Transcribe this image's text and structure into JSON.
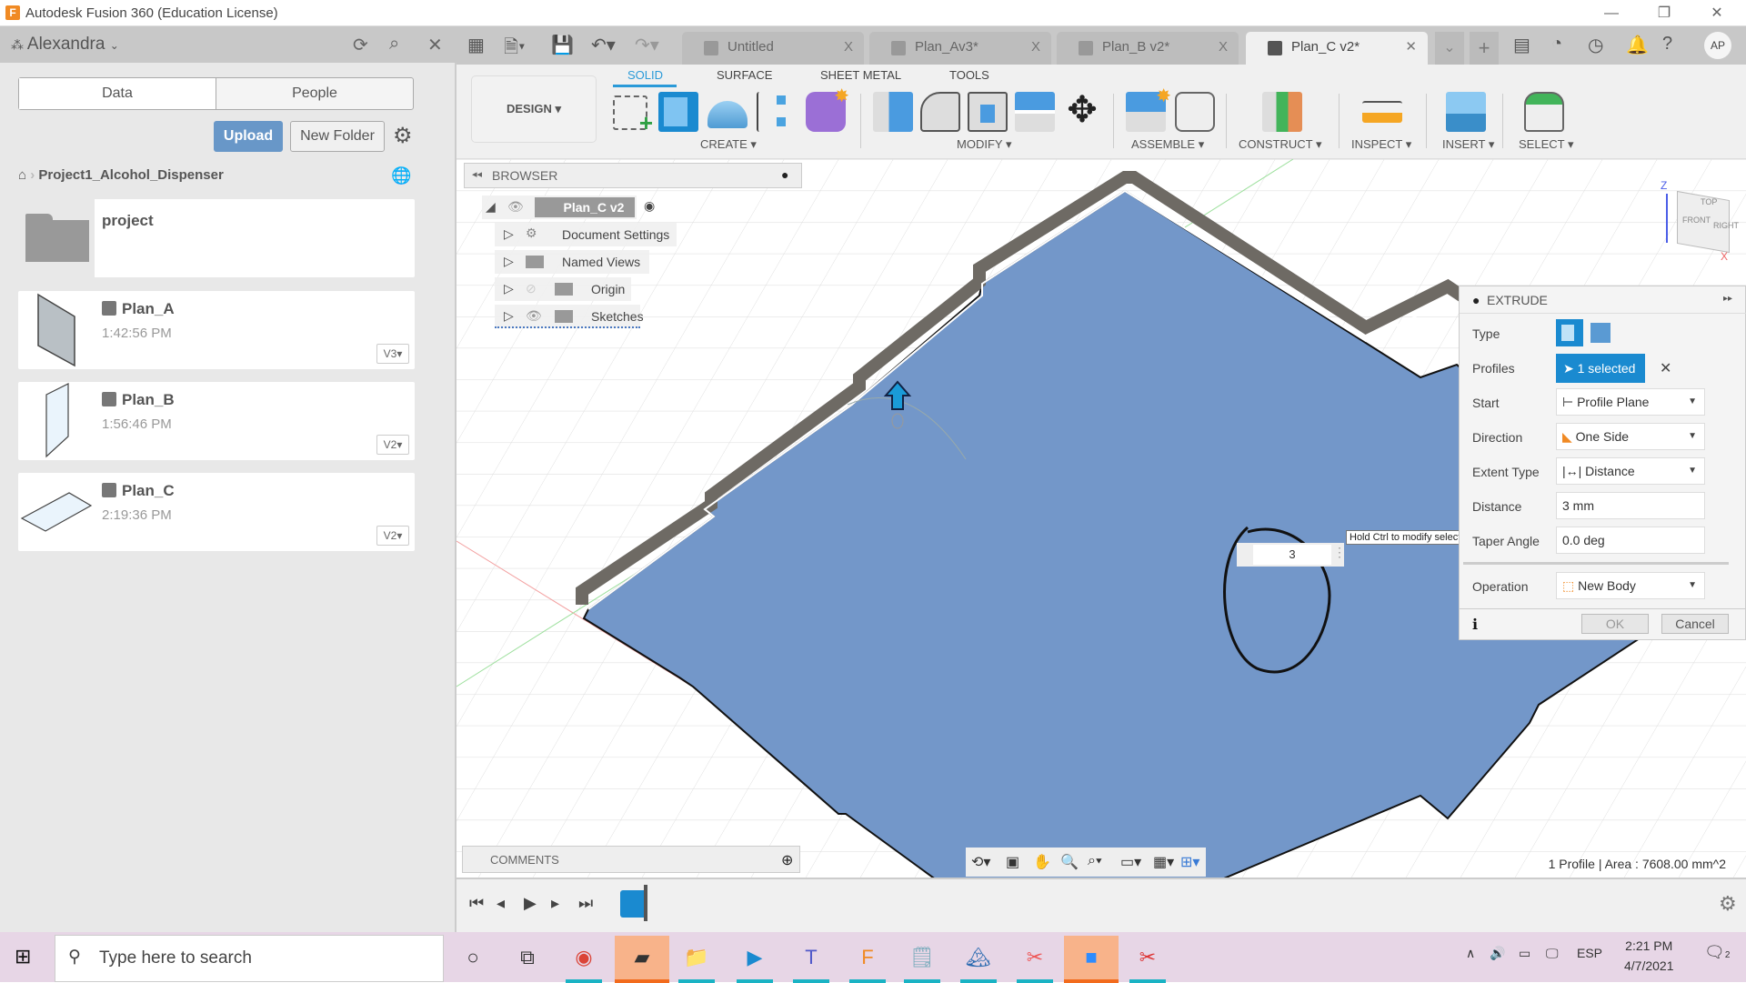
{
  "window": {
    "title": "Autodesk Fusion 360 (Education License)",
    "logo": "F"
  },
  "left_panel": {
    "user": "Alexandra",
    "tabs": [
      {
        "label": "Data",
        "active": true
      },
      {
        "label": "People",
        "active": false
      }
    ],
    "upload_label": "Upload",
    "new_folder_label": "New Folder",
    "breadcrumb": "Project1_Alcohol_Dispenser",
    "folder": {
      "name": "project"
    },
    "files": [
      {
        "name": "Plan_A",
        "time": "1:42:56 PM",
        "version": "V3"
      },
      {
        "name": "Plan_B",
        "time": "1:56:46 PM",
        "version": "V2"
      },
      {
        "name": "Plan_C",
        "time": "2:19:36 PM",
        "version": "V2"
      }
    ]
  },
  "doc_tabs": [
    {
      "label": "Untitled",
      "active": false
    },
    {
      "label": "Plan_Av3*",
      "active": false
    },
    {
      "label": "Plan_B v2*",
      "active": false
    },
    {
      "label": "Plan_C v2*",
      "active": true
    }
  ],
  "header": {
    "avatar": "AP"
  },
  "toolbar": {
    "workspace": "DESIGN",
    "tabs": [
      {
        "label": "SOLID",
        "active": true
      },
      {
        "label": "SURFACE",
        "active": false
      },
      {
        "label": "SHEET METAL",
        "active": false
      },
      {
        "label": "TOOLS",
        "active": false
      }
    ],
    "groups": [
      "CREATE",
      "MODIFY",
      "ASSEMBLE",
      "CONSTRUCT",
      "INSPECT",
      "INSERT",
      "SELECT"
    ]
  },
  "browser": {
    "title": "BROWSER",
    "root": "Plan_C v2",
    "items": [
      "Document Settings",
      "Named Views",
      "Origin",
      "Sketches"
    ]
  },
  "viewcube": {
    "top": "TOP",
    "front": "FRONT",
    "right": "RIGHT",
    "z": "Z",
    "x": "X"
  },
  "extrude": {
    "title": "EXTRUDE",
    "rows": {
      "type": "Type",
      "profiles": "Profiles",
      "profiles_value": "1 selected",
      "start": "Start",
      "start_value": "Profile Plane",
      "direction": "Direction",
      "direction_value": "One Side",
      "extent_type": "Extent Type",
      "extent_value": "Distance",
      "distance": "Distance",
      "distance_value": "3 mm",
      "taper": "Taper Angle",
      "taper_value": "0.0 deg",
      "operation": "Operation",
      "operation_value": "New Body"
    },
    "ok": "OK",
    "cancel": "Cancel"
  },
  "canvas": {
    "distance_input": "3",
    "tooltip": "Hold Ctrl to modify selection",
    "accent": "#7397c9"
  },
  "comments": {
    "title": "COMMENTS"
  },
  "status": "1 Profile | Area : 7608.00 mm^2",
  "taskbar": {
    "search_placeholder": "Type here to search",
    "lang": "ESP",
    "time": "2:21 PM",
    "date": "4/7/2021",
    "notifications": "2"
  }
}
